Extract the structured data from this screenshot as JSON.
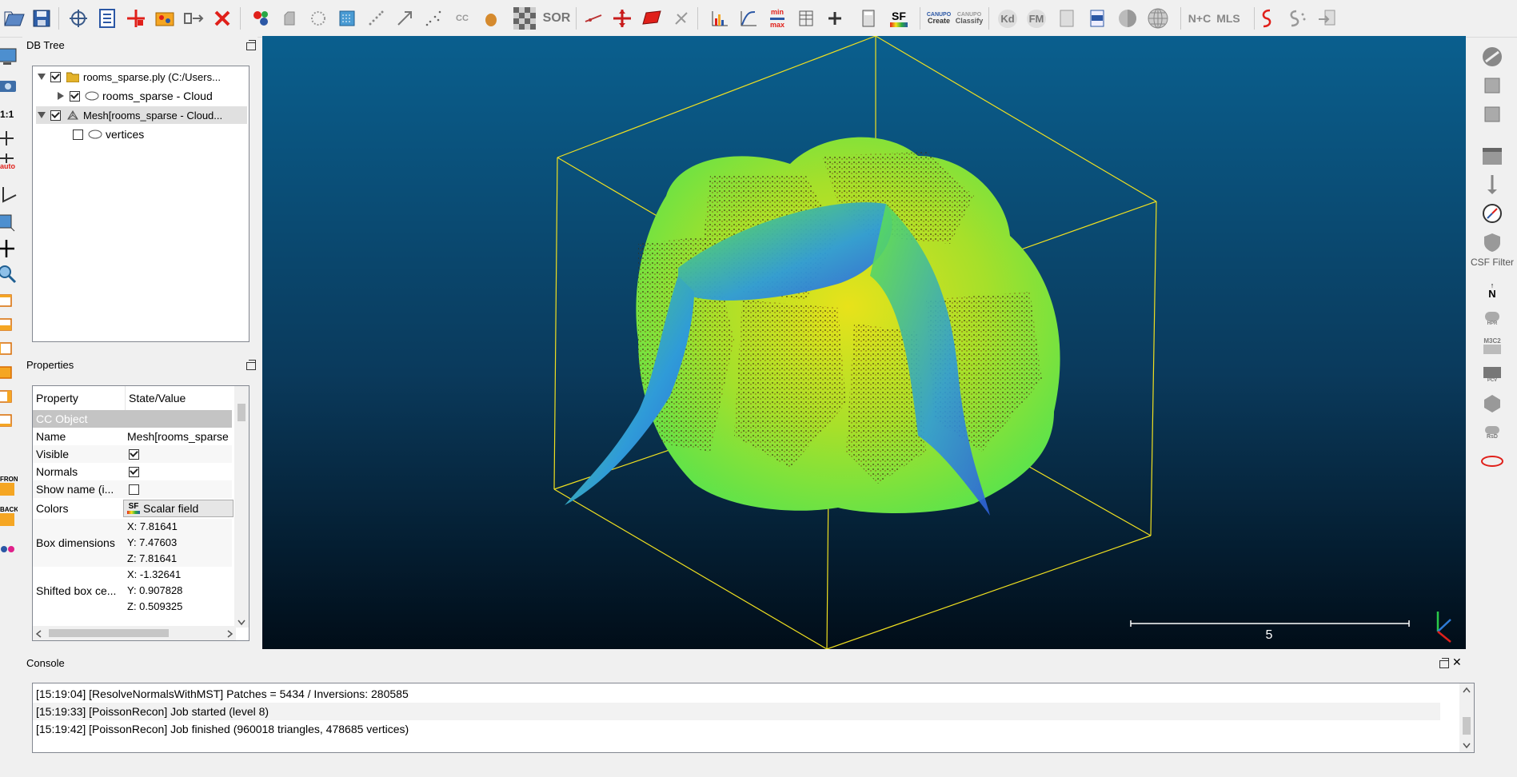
{
  "toolbar": {
    "icons": [
      "open-icon",
      "save-icon",
      "point-picking-icon",
      "point-list-icon",
      "translate-icon",
      "merge-icon",
      "segment-icon",
      "delete-icon",
      "sample-icon",
      "hidden-point-icon",
      "noise-filter-icon",
      "subsample-icon",
      "crop-icon",
      "fine-registration-icon",
      "clone-icon",
      "ellipsoid-icon",
      "checker-icon",
      "sor-icon",
      "cross-section-icon",
      "pivot-icon",
      "plane-icon",
      "point-pair-icon",
      "histogram-icon",
      "curve-icon",
      "min-max-icon",
      "table-icon",
      "plus-icon",
      "calculator-icon",
      "scalar-field-icon",
      "canupo-create-icon",
      "canupo-classify-icon",
      "kd-icon",
      "fm-icon",
      "doc-icon",
      "csv-icon",
      "sphere-icon",
      "globe-icon",
      "n-c-icon",
      "mls-icon",
      "snake-icon",
      "ss-icon",
      "arrow-icon"
    ],
    "labels": {
      "sor": "SOR",
      "min": "min",
      "max": "max",
      "sf": "SF",
      "canupo1": "CANUPO",
      "create": "Create",
      "canupo2": "CANUPO",
      "classify": "Classify",
      "kd": "Kd",
      "fm": "FM",
      "nc": "N+C",
      "mls": "MLS",
      "cc": "CC"
    }
  },
  "left_toolbar": {
    "labels": {
      "ratio": "1:1",
      "auto": "auto",
      "front": "FRONT",
      "back": "BACK"
    }
  },
  "db_tree": {
    "title": "DB Tree",
    "items": [
      {
        "label": "rooms_sparse.ply (C:/Users...",
        "checked": true
      },
      {
        "label": "rooms_sparse - Cloud",
        "checked": true
      },
      {
        "label": "Mesh[rooms_sparse - Cloud...",
        "checked": true
      },
      {
        "label": "vertices",
        "checked": false
      }
    ]
  },
  "properties": {
    "title": "Properties",
    "headers": {
      "property": "Property",
      "value": "State/Value"
    },
    "section": "CC Object",
    "rows": {
      "name": {
        "label": "Name",
        "value": "Mesh[rooms_sparse"
      },
      "visible": {
        "label": "Visible",
        "checked": true
      },
      "normals": {
        "label": "Normals",
        "checked": true
      },
      "show_name": {
        "label": "Show name (i...",
        "checked": false
      },
      "colors": {
        "label": "Colors",
        "sf": "SF",
        "value": "Scalar field"
      },
      "box_dims": {
        "label": "Box dimensions",
        "x": "X: 7.81641",
        "y": "Y: 7.47603",
        "z": "Z: 7.81641"
      },
      "shifted": {
        "label": "Shifted box ce...",
        "x": "X: -1.32641",
        "y": "Y: 0.907828",
        "z": "Z: 0.509325"
      }
    }
  },
  "view3d": {
    "scale_label": "5"
  },
  "right_toolbar": {
    "csf_label": "CSF Filter",
    "n_label": "N",
    "hpr": "HPR",
    "m3c2": "M3C2",
    "pcv": "PCV",
    "rsd": "RsD"
  },
  "console": {
    "title": "Console",
    "lines": [
      "[15:19:04] [ResolveNormalsWithMST] Patches = 5434 / Inversions: 280585",
      "[15:19:33] [PoissonRecon] Job started (level 8)",
      "[15:19:42] [PoissonRecon] Job finished (960018 triangles, 478685 vertices)"
    ]
  },
  "colors": {
    "accent_red": "#e0201a",
    "mesh_green": "#5fe34a",
    "mesh_yellow": "#e8e21a",
    "mesh_blue": "#2f7bd8",
    "bbox_yellow": "#f0e020"
  }
}
